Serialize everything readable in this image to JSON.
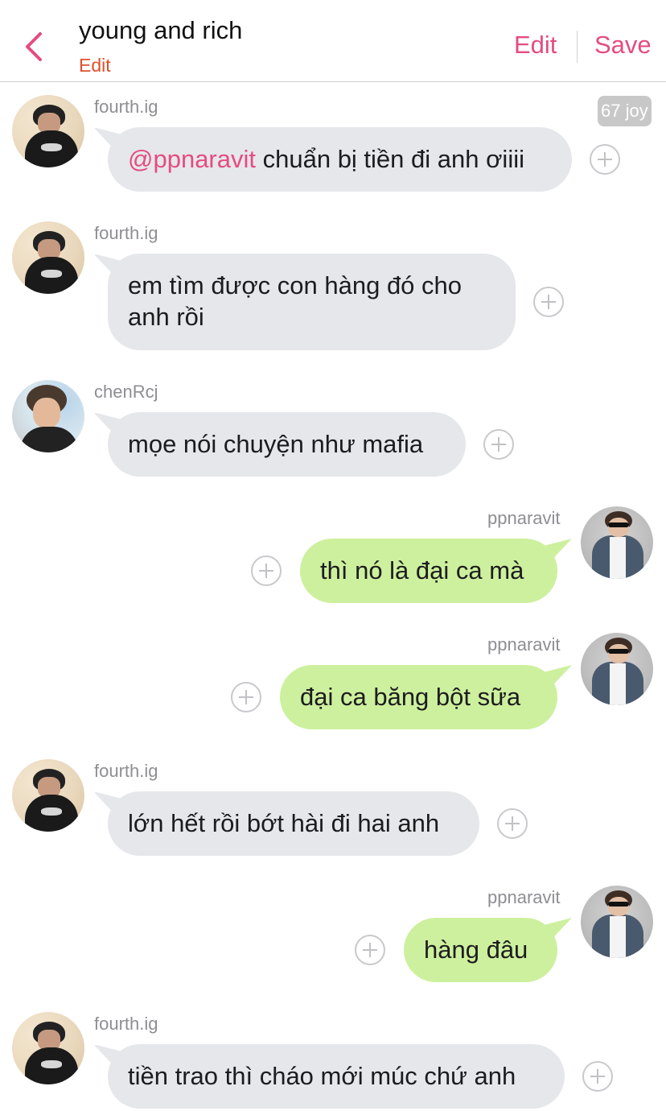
{
  "header": {
    "title": "young and rich",
    "subtitle_edit": "Edit",
    "edit_label": "Edit",
    "save_label": "Save"
  },
  "badge": {
    "text": "67 joy"
  },
  "messages": [
    {
      "sender": "fourth.ig",
      "mention": "@ppnaravit",
      "text": " chuẩn bị tiền đi anh ơiiii",
      "side": "incoming"
    },
    {
      "sender": "fourth.ig",
      "text": "em tìm được con hàng đó cho anh rồi",
      "side": "incoming"
    },
    {
      "sender": "chenRcj",
      "text": "mọe nói chuyện như mafia",
      "side": "incoming"
    },
    {
      "sender": "ppnaravit",
      "text": "thì nó là đại ca mà",
      "side": "outgoing"
    },
    {
      "sender": "ppnaravit",
      "text": "đại ca băng bột sữa",
      "side": "outgoing"
    },
    {
      "sender": "fourth.ig",
      "text": "lớn hết rồi bớt hài đi hai anh",
      "side": "incoming"
    },
    {
      "sender": "ppnaravit",
      "text": "hàng đâu",
      "side": "outgoing"
    },
    {
      "sender": "fourth.ig",
      "text": "tiền trao thì cháo mới múc chứ anh",
      "side": "incoming"
    }
  ],
  "colors": {
    "accent": "#e54c7f",
    "incoming_bubble": "#e5e7eb",
    "outgoing_bubble": "#cdf09e",
    "title_edit": "#e0502d"
  }
}
